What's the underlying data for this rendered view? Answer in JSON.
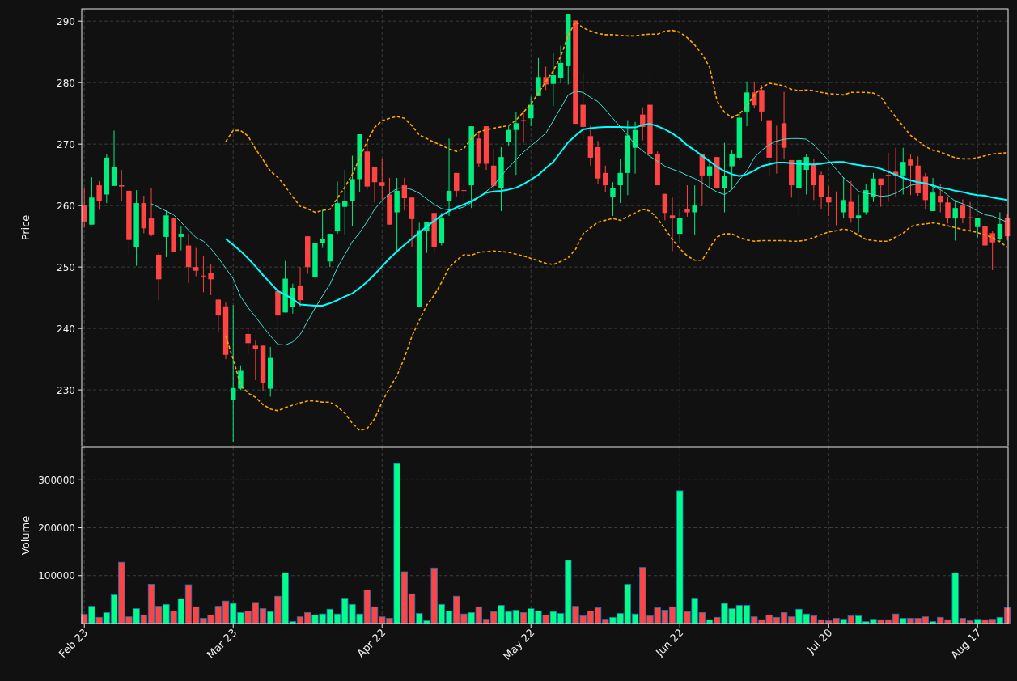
{
  "price_panel": {
    "chart_data": {
      "type": "candlestick",
      "ylabel": "Price",
      "grid": true,
      "categories": [
        null,
        null,
        null,
        null,
        null,
        null,
        null,
        null,
        null,
        null,
        null,
        null,
        null,
        null,
        null,
        null,
        null,
        null,
        null,
        null,
        null,
        null,
        null,
        null,
        null,
        null,
        null,
        null,
        null,
        null,
        null,
        null,
        null,
        null,
        null,
        null,
        null,
        null,
        null,
        null,
        null,
        null,
        null,
        null,
        null,
        null,
        null,
        null,
        null,
        null,
        null,
        null,
        null,
        null,
        null,
        null,
        null,
        null,
        null,
        null,
        null,
        null,
        null,
        null,
        null,
        null,
        null,
        null,
        null,
        null,
        null,
        null,
        null,
        null,
        null,
        null,
        null,
        null,
        null,
        null,
        null,
        null,
        null,
        null,
        null,
        null,
        null,
        null,
        null,
        null,
        null,
        null,
        null,
        null,
        null,
        null,
        null,
        null,
        null,
        null,
        null,
        null,
        null,
        null,
        null,
        null,
        null,
        null,
        null,
        null,
        null,
        null,
        null,
        null,
        null,
        null,
        null,
        null,
        null,
        null,
        null,
        null,
        null,
        null,
        null
      ],
      "ylim": [
        220.8,
        292
      ],
      "yticks": [
        230,
        240,
        250,
        260,
        270,
        280,
        290
      ],
      "ohlc": [
        [
          260,
          262.8,
          256.4,
          257.4
        ],
        [
          256.9,
          264.6,
          256.9,
          261.3
        ],
        [
          263.3,
          264,
          259.3,
          260.8
        ],
        [
          261.8,
          268.3,
          260.4,
          267.8
        ],
        [
          263.2,
          272.2,
          263.2,
          266.3
        ],
        [
          263.3,
          265.8,
          260.8,
          263.1
        ],
        [
          262.4,
          262.4,
          251.8,
          254.4
        ],
        [
          253.3,
          262.5,
          250.2,
          260.4
        ],
        [
          260.4,
          261.6,
          255.5,
          256.3
        ],
        [
          257.9,
          262.8,
          255,
          255.3
        ],
        [
          252,
          252.3,
          244.6,
          248
        ],
        [
          254.9,
          259.2,
          251.6,
          258.4
        ],
        [
          257.9,
          258,
          252.4,
          252.4
        ],
        [
          254.9,
          256.6,
          252.7,
          255.4
        ],
        [
          253.5,
          255.4,
          247.4,
          250
        ],
        [
          250,
          253.1,
          248.5,
          249.4
        ],
        [
          248.6,
          251.8,
          245.9,
          248.5
        ],
        [
          249,
          250.4,
          245.4,
          248
        ],
        [
          244.7,
          244.7,
          239.4,
          242.1
        ],
        [
          243.6,
          244.2,
          235,
          235.7
        ],
        [
          228.3,
          243.8,
          221.5,
          230.3
        ],
        [
          230.2,
          234,
          230,
          233.1
        ],
        [
          239.1,
          240.1,
          235.8,
          237.6
        ],
        [
          237.2,
          238,
          231.6,
          236.6
        ],
        [
          237.2,
          237.2,
          229.8,
          231.1
        ],
        [
          230.2,
          237,
          228.9,
          235.2
        ],
        [
          246.1,
          246.1,
          237.6,
          242.1
        ],
        [
          242.6,
          251,
          242.6,
          248.1
        ],
        [
          243.5,
          247.3,
          242.4,
          246.6
        ],
        [
          247,
          250,
          243.5,
          244.6
        ],
        [
          255,
          255,
          248.9,
          250
        ],
        [
          248.4,
          253.9,
          248.4,
          253.9
        ],
        [
          253.9,
          259.3,
          253.1,
          254.5
        ],
        [
          250.9,
          255.4,
          250,
          255.4
        ],
        [
          255.8,
          263.9,
          255.4,
          260.4
        ],
        [
          259.8,
          265.8,
          255.3,
          260.8
        ],
        [
          260.8,
          268.1,
          256.6,
          264.3
        ],
        [
          264.3,
          271.6,
          262.2,
          271.6
        ],
        [
          268.8,
          270.5,
          262.7,
          263.1
        ],
        [
          266.3,
          266.3,
          260.5,
          263.8
        ],
        [
          263.8,
          267.7,
          260.9,
          263.2
        ],
        [
          261.8,
          264.5,
          256.9,
          256.9
        ],
        [
          258.9,
          264.5,
          252.6,
          262.4
        ],
        [
          263.3,
          264.5,
          259.2,
          261.2
        ],
        [
          261.3,
          261.3,
          253.3,
          257.8
        ],
        [
          243.5,
          257.2,
          243.5,
          256
        ],
        [
          255.8,
          257.3,
          252.3,
          257.3
        ],
        [
          258.8,
          258.8,
          252.3,
          253.3
        ],
        [
          253.9,
          258.8,
          253.5,
          257.9
        ],
        [
          260.8,
          270.9,
          258.3,
          262.4
        ],
        [
          265.3,
          265.3,
          261.5,
          262.4
        ],
        [
          262.5,
          263.5,
          259.8,
          262.4
        ],
        [
          263.3,
          272.9,
          259.6,
          272.9
        ],
        [
          270.9,
          272.1,
          266.3,
          266.8
        ],
        [
          272.9,
          272.9,
          265.8,
          266.8
        ],
        [
          266.5,
          269.2,
          262.2,
          263.2
        ],
        [
          262.9,
          269.5,
          259.1,
          267.9
        ],
        [
          270.3,
          272.9,
          269.7,
          272.3
        ],
        [
          272.3,
          275.2,
          265,
          273.4
        ],
        [
          273.9,
          275.2,
          270.2,
          273.8
        ],
        [
          274.2,
          277.7,
          272.9,
          276.4
        ],
        [
          277.8,
          284,
          277.8,
          280.9
        ],
        [
          280.9,
          282.6,
          278.8,
          279.7
        ],
        [
          279.8,
          284.8,
          276.2,
          281.2
        ],
        [
          280.8,
          286,
          279.9,
          283.2
        ],
        [
          282.8,
          291.2,
          279.7,
          291.2
        ],
        [
          290.1,
          290.1,
          273.3,
          273.3
        ],
        [
          276.4,
          281.6,
          270.8,
          272.8
        ],
        [
          271.3,
          273,
          266.5,
          267.8
        ],
        [
          269.5,
          270.5,
          263.5,
          264.4
        ],
        [
          265.3,
          266.5,
          262.2,
          263.3
        ],
        [
          261.4,
          263.8,
          258.3,
          262.8
        ],
        [
          263.3,
          267.6,
          260.4,
          265.3
        ],
        [
          265.3,
          273.9,
          261.7,
          271.4
        ],
        [
          269.4,
          273.6,
          265.2,
          272.3
        ],
        [
          274.8,
          276,
          270.6,
          272.8
        ],
        [
          276.4,
          281.2,
          267.9,
          268.3
        ],
        [
          268.4,
          268.8,
          263.3,
          263.3
        ],
        [
          261.9,
          261.9,
          257.6,
          258.8
        ],
        [
          258.4,
          261.3,
          252.6,
          257.9
        ],
        [
          255.4,
          259.4,
          253.9,
          258
        ],
        [
          259.5,
          263.3,
          258.2,
          258.9
        ],
        [
          258.9,
          263.3,
          255.2,
          260
        ],
        [
          268.4,
          268.4,
          259.9,
          264.9
        ],
        [
          264.9,
          267.4,
          262.9,
          266.4
        ],
        [
          267.9,
          267.9,
          262.8,
          262.8
        ],
        [
          262.8,
          270.2,
          258.9,
          264.8
        ],
        [
          266.4,
          269,
          262.6,
          268.4
        ],
        [
          267.8,
          275.2,
          267.4,
          274.3
        ],
        [
          275.3,
          280.2,
          272.9,
          278.4
        ],
        [
          278.4,
          280.2,
          275.9,
          276.3
        ],
        [
          278.8,
          279.6,
          273.8,
          275.3
        ],
        [
          273.9,
          273.9,
          264.9,
          267.8
        ],
        [
          270.5,
          273,
          265.2,
          270.3
        ],
        [
          273.4,
          278.5,
          267.5,
          269.4
        ],
        [
          267.4,
          267.4,
          261.3,
          263.3
        ],
        [
          262.8,
          267.6,
          258.4,
          267.4
        ],
        [
          265.8,
          268.4,
          261.8,
          267.9
        ],
        [
          266.7,
          267.6,
          260.9,
          263.3
        ],
        [
          265,
          265.5,
          259.5,
          261.4
        ],
        [
          261.4,
          263.2,
          258.3,
          260.5
        ],
        [
          259.5,
          262.3,
          256.8,
          259.4
        ],
        [
          258.9,
          264.6,
          257.9,
          260.9
        ],
        [
          260.6,
          264,
          257.2,
          257.9
        ],
        [
          257.9,
          261.8,
          255.6,
          258.4
        ],
        [
          258.9,
          263.5,
          258.5,
          262.5
        ],
        [
          261.4,
          265.3,
          260.6,
          264.4
        ],
        [
          264.4,
          264.4,
          259.8,
          263.3
        ],
        [
          265,
          268.6,
          260.6,
          264.9
        ],
        [
          265.5,
          269.4,
          261.3,
          264.9
        ],
        [
          264.9,
          269.4,
          261.8,
          267.1
        ],
        [
          267.5,
          268.4,
          261.7,
          266.5
        ],
        [
          266.5,
          268,
          261.6,
          262
        ],
        [
          264.7,
          265.3,
          259.5,
          260.9
        ],
        [
          259.1,
          264.5,
          259.1,
          262.1
        ],
        [
          261.6,
          263.5,
          258.9,
          260.5
        ],
        [
          260.5,
          261.4,
          257.1,
          257.9
        ],
        [
          257.9,
          260.9,
          254.3,
          259.6
        ],
        [
          260,
          261,
          257.1,
          257.9
        ],
        [
          258.1,
          260.6,
          255.7,
          258
        ],
        [
          256.5,
          258,
          254.8,
          258
        ],
        [
          256.6,
          258,
          253.1,
          253.5
        ],
        [
          255.5,
          255.8,
          249.5,
          254
        ],
        [
          254.6,
          258.9,
          254.2,
          257
        ],
        [
          258,
          258.6,
          254.3,
          255
        ]
      ],
      "series": [
        {
          "type": "line",
          "line_style": "solid",
          "color": "#40e0d0",
          "values": [
            null,
            null,
            null,
            null,
            null,
            null,
            null,
            null,
            null,
            260.3,
            259.7,
            259.1,
            258.5,
            257.3,
            256,
            254.8,
            254.2,
            253,
            251.5,
            249.8,
            248.1,
            245.2,
            243.4,
            241.9,
            240.3,
            238.8,
            237.4,
            237.3,
            237.8,
            239,
            241.2,
            243.3,
            245.3,
            247.2,
            249.9,
            252,
            254.1,
            255.6,
            257.4,
            259.4,
            260.8,
            261.9,
            262.8,
            262.9,
            262.6,
            262,
            261.1,
            260.2,
            259.5,
            259.3,
            259.4,
            259.8,
            260.5,
            261.3,
            262.3,
            263.3,
            264.8,
            266.2,
            267.5,
            268.7,
            269.7,
            270.7,
            271.8,
            273.8,
            275.9,
            278,
            278.6,
            278.4,
            277.6,
            276.9,
            275.6,
            274.2,
            272.8,
            271.4,
            269.9,
            268.9,
            268,
            267.2,
            266.4,
            265.9,
            265.5,
            264.9,
            264.4,
            263.7,
            262.9,
            262.2,
            261.8,
            262.6,
            264.2,
            265.6,
            267.8,
            269,
            269.9,
            270.5,
            270.8,
            270.9,
            270.9,
            270.8,
            269.9,
            268.6,
            267.3,
            265.9,
            264.5,
            263.5,
            262.3,
            262,
            261.8,
            261.5,
            261.6,
            262,
            262.7,
            263.3,
            263.5,
            263.7,
            263.1,
            262.6,
            261.7,
            260.7,
            260.3,
            259.8,
            259.1,
            258.5,
            258.3,
            257.8,
            257.3
          ]
        },
        {
          "type": "line",
          "line_style": "solid",
          "color": "#00ffff",
          "values": [
            null,
            null,
            null,
            null,
            null,
            null,
            null,
            null,
            null,
            null,
            null,
            null,
            null,
            null,
            null,
            null,
            null,
            null,
            null,
            254.6,
            253.6,
            252.6,
            251.4,
            250.1,
            248.7,
            247.4,
            246.1,
            245.5,
            244.8,
            243.9,
            243.8,
            243.7,
            243.7,
            244.1,
            244.6,
            245.2,
            245.7,
            246.6,
            247.6,
            248.8,
            250.1,
            251.4,
            252.5,
            253.6,
            254.6,
            255.6,
            256.6,
            257.5,
            258.4,
            259.1,
            259.7,
            260.2,
            260.7,
            261.4,
            262.1,
            262.3,
            262.4,
            262.6,
            262.9,
            263.5,
            264.2,
            265,
            266.1,
            267.1,
            268.7,
            270.3,
            271.4,
            272.4,
            272.6,
            272.7,
            272.8,
            272.8,
            272.8,
            272.7,
            272.7,
            273.1,
            273.3,
            272.9,
            272.4,
            271.7,
            270.9,
            269.8,
            269,
            268.1,
            267.2,
            266.3,
            265.6,
            265.1,
            264.8,
            265.1,
            265.7,
            266.4,
            266.7,
            267,
            267,
            266.9,
            266.8,
            266.7,
            266.7,
            266.8,
            267,
            267.1,
            267.1,
            266.8,
            266.6,
            266.4,
            266.3,
            266,
            265.5,
            265,
            264.5,
            264.1,
            263.8,
            263.6,
            263.3,
            262.9,
            262.7,
            262.4,
            262.2,
            261.9,
            261.7,
            261.6,
            261.3,
            261.1,
            260.9
          ]
        },
        {
          "type": "line",
          "line_style": "dashed",
          "color": "#ffa500",
          "values": [
            null,
            null,
            null,
            null,
            null,
            null,
            null,
            null,
            null,
            null,
            null,
            null,
            null,
            null,
            null,
            null,
            null,
            null,
            null,
            270.4,
            272.2,
            272.2,
            271.3,
            269.2,
            267.5,
            265.6,
            264.6,
            263.1,
            261.4,
            259.9,
            259.5,
            258.9,
            259.2,
            259.4,
            261.2,
            263,
            265.1,
            267.7,
            270.5,
            272.7,
            273.8,
            274.2,
            274.5,
            274.2,
            273,
            271.5,
            270.9,
            270.3,
            269.8,
            269.2,
            268.8,
            269.3,
            270.9,
            272,
            272.3,
            272.6,
            272.8,
            273,
            273.9,
            275.2,
            276.5,
            278.3,
            280.2,
            281.9,
            284.3,
            287.7,
            289.9,
            288.9,
            288.4,
            288,
            287.8,
            287.8,
            287.7,
            287.6,
            287.6,
            287.8,
            287.9,
            287.9,
            288.4,
            288.5,
            288.2,
            287.3,
            286.1,
            284.6,
            282.5,
            277,
            275.2,
            274.3,
            274.9,
            276.2,
            278,
            279.2,
            279.9,
            279.7,
            279.5,
            278.9,
            278.7,
            278.8,
            278.7,
            278.4,
            278.2,
            278.1,
            278,
            278.4,
            278.4,
            278.4,
            278.3,
            277.7,
            276,
            274.4,
            272.9,
            271.4,
            270.5,
            269.6,
            269,
            268.7,
            268.2,
            267.8,
            267.6,
            267.6,
            267.8,
            268.1,
            268.4,
            268.5,
            268.6
          ]
        },
        {
          "type": "line",
          "line_style": "dashed",
          "color": "#ffa500",
          "values": [
            null,
            null,
            null,
            null,
            null,
            null,
            null,
            null,
            null,
            null,
            null,
            null,
            null,
            null,
            null,
            null,
            null,
            null,
            null,
            238.8,
            235,
            230.8,
            229.5,
            228.8,
            227.6,
            226.9,
            226.6,
            227.1,
            227.5,
            227.9,
            228.2,
            228.2,
            228,
            228,
            227.3,
            226.2,
            224.6,
            223.4,
            223.7,
            225.3,
            228,
            230.3,
            232.3,
            235.2,
            238.7,
            241.3,
            243.8,
            245.4,
            247.5,
            249.9,
            251.1,
            252,
            251.9,
            252.4,
            252.5,
            252.6,
            252.5,
            252.4,
            252.1,
            251.8,
            251.4,
            251,
            250.6,
            250.4,
            250.9,
            251.5,
            252.9,
            255.4,
            256.4,
            257.3,
            257.6,
            257.9,
            257.6,
            258.2,
            258.8,
            259.4,
            259.1,
            257.9,
            256.2,
            254.5,
            253,
            251.8,
            251.1,
            251.1,
            253.1,
            254.9,
            255.4,
            255.4,
            254.8,
            254.4,
            254.2,
            254.3,
            254.3,
            254.3,
            254.3,
            254.2,
            254.2,
            254.4,
            254.8,
            255.3,
            255.7,
            255.9,
            256.2,
            255.9,
            255.2,
            254.5,
            254.3,
            254.2,
            254.2,
            254.9,
            255.5,
            256.6,
            256.9,
            257,
            257.2,
            257,
            256.7,
            256.4,
            256.1,
            255.9,
            255.6,
            255.2,
            254.8,
            254.1,
            253.2
          ]
        }
      ]
    }
  },
  "volume_panel": {
    "chart_data": {
      "type": "bar",
      "stacked": true,
      "grid": true,
      "ylabel": "Volume",
      "categories": [
        "Feb 23",
        null,
        null,
        null,
        null,
        null,
        null,
        null,
        null,
        null,
        null,
        null,
        null,
        null,
        null,
        null,
        null,
        null,
        null,
        null,
        "Mar 23",
        null,
        null,
        null,
        null,
        null,
        null,
        null,
        null,
        null,
        null,
        null,
        null,
        null,
        null,
        null,
        null,
        null,
        null,
        null,
        "Apr 22",
        null,
        null,
        null,
        null,
        null,
        null,
        null,
        null,
        null,
        null,
        null,
        null,
        null,
        null,
        null,
        null,
        null,
        null,
        null,
        "May 22",
        null,
        null,
        null,
        null,
        null,
        null,
        null,
        null,
        null,
        null,
        null,
        null,
        null,
        null,
        null,
        null,
        null,
        null,
        null,
        "Jun 22",
        null,
        null,
        null,
        null,
        null,
        null,
        null,
        null,
        null,
        null,
        null,
        null,
        null,
        null,
        null,
        null,
        null,
        null,
        null,
        "Jul 20",
        null,
        null,
        null,
        null,
        null,
        null,
        null,
        null,
        null,
        null,
        null,
        null,
        null,
        null,
        null,
        null,
        null,
        null,
        null,
        "Aug 17",
        null,
        null,
        null,
        null
      ],
      "ylim": [
        0,
        368000
      ],
      "yticks": [
        100000,
        200000,
        300000
      ],
      "series": [
        {
          "color": "#00ff88",
          "values": [
            null,
            36000,
            null,
            23000,
            60000,
            null,
            null,
            31000,
            null,
            null,
            null,
            40000,
            null,
            52000,
            null,
            null,
            null,
            null,
            null,
            null,
            42000,
            23000,
            null,
            null,
            null,
            25000,
            null,
            106000,
            4000,
            null,
            null,
            18000,
            20000,
            30000,
            20000,
            53000,
            40000,
            20000,
            null,
            null,
            null,
            null,
            334000,
            null,
            null,
            21000,
            6000,
            null,
            40000,
            26000,
            null,
            null,
            23000,
            null,
            null,
            null,
            38000,
            25000,
            28000,
            null,
            31000,
            26000,
            null,
            25000,
            21000,
            132000,
            null,
            null,
            null,
            null,
            null,
            13000,
            21000,
            82000,
            20000,
            null,
            null,
            null,
            null,
            null,
            277000,
            null,
            53000,
            null,
            8000,
            null,
            42000,
            31000,
            38000,
            38000,
            null,
            null,
            null,
            null,
            null,
            null,
            30000,
            20000,
            null,
            null,
            null,
            null,
            9000,
            null,
            16000,
            4000,
            9000,
            null,
            null,
            null,
            11000,
            null,
            null,
            null,
            4000,
            null,
            null,
            106000,
            null,
            null,
            9000,
            null,
            null,
            13000,
            null
          ]
        },
        {
          "color": "#ff4444",
          "values": [
            19000,
            null,
            13000,
            null,
            null,
            128000,
            14000,
            null,
            18000,
            82000,
            36000,
            null,
            26000,
            null,
            81000,
            35000,
            11000,
            18000,
            36000,
            47000,
            null,
            null,
            26000,
            44000,
            31000,
            null,
            57000,
            null,
            null,
            14000,
            23000,
            null,
            null,
            null,
            null,
            null,
            null,
            null,
            70000,
            35000,
            14000,
            11000,
            null,
            108000,
            62000,
            null,
            null,
            116000,
            null,
            null,
            57000,
            20000,
            null,
            35000,
            9000,
            25000,
            null,
            null,
            null,
            23000,
            null,
            null,
            18000,
            null,
            null,
            null,
            36000,
            16000,
            26000,
            33000,
            9000,
            null,
            null,
            null,
            null,
            117000,
            16000,
            33000,
            28000,
            35000,
            null,
            25000,
            null,
            23000,
            null,
            13000,
            null,
            null,
            null,
            null,
            14000,
            8000,
            18000,
            13000,
            23000,
            14000,
            null,
            null,
            16000,
            8000,
            6000,
            11000,
            null,
            16000,
            null,
            null,
            null,
            8000,
            8000,
            20000,
            null,
            11000,
            11000,
            14000,
            null,
            13000,
            8000,
            null,
            11000,
            6000,
            null,
            8000,
            9000,
            null,
            33000
          ]
        }
      ]
    }
  }
}
